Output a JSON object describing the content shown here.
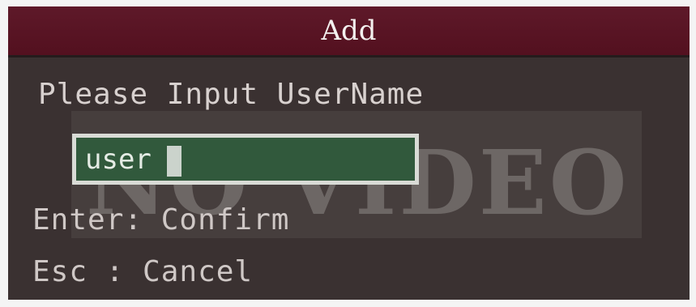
{
  "dialog": {
    "title": "Add",
    "prompt": "Please Input UserName",
    "input": {
      "value": "user"
    },
    "shortcuts": {
      "confirm": "Enter: Confirm",
      "cancel": "Esc  : Cancel"
    }
  },
  "overlay": {
    "text": "NO VIDEO"
  },
  "colors": {
    "title_bar": "#5e1929",
    "dialog_background": "#3a3131",
    "input_background": "#31593c",
    "input_border": "#d9dbd6",
    "text": "#d8d1cf"
  },
  "icons": {
    "caret": "text-cursor-icon"
  }
}
